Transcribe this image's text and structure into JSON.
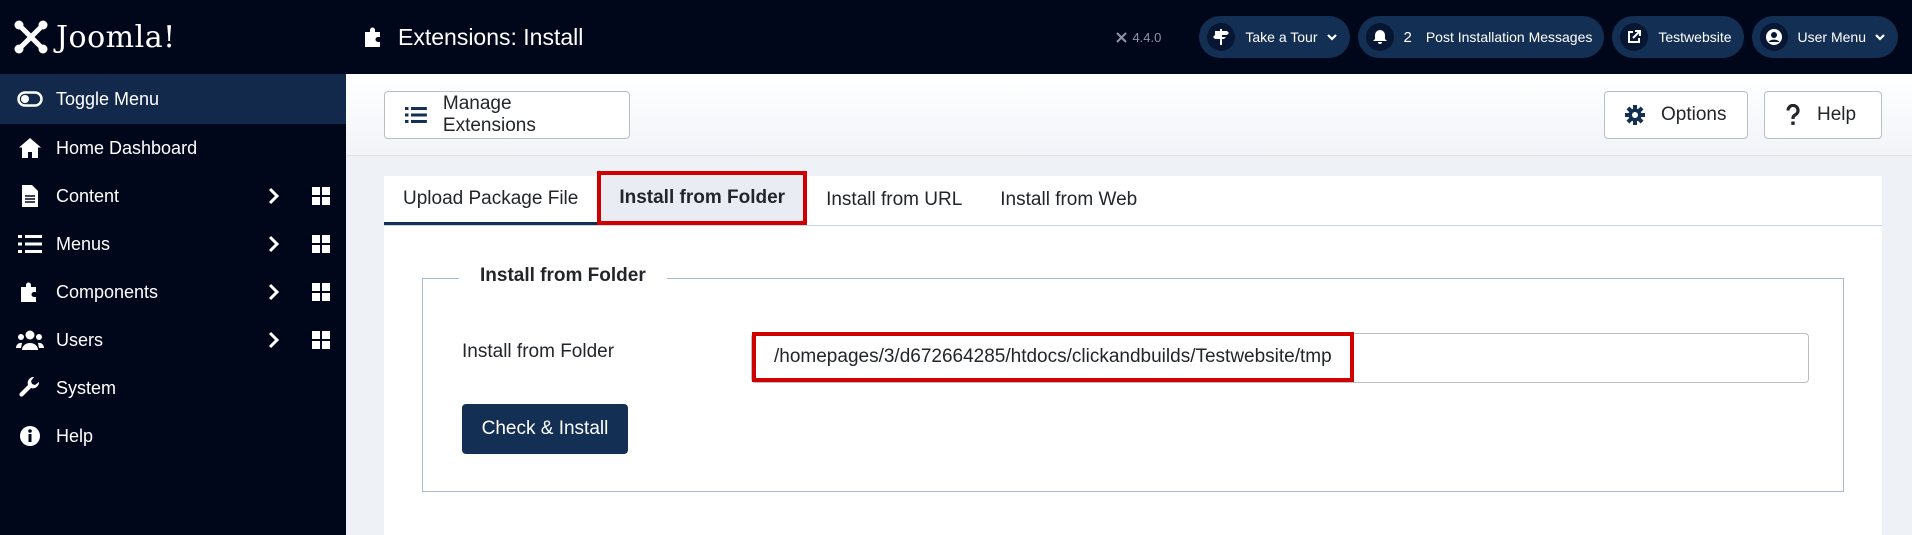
{
  "brand": {
    "logo_text": "Joomla!"
  },
  "header": {
    "page_title": "Extensions: Install",
    "version": "4.4.0",
    "tour_label": "Take a Tour",
    "messages_count": "2",
    "messages_label": "Post Installation Messages",
    "site_label": "Testwebsite",
    "user_menu_label": "User Menu"
  },
  "sidebar": {
    "items": [
      {
        "label": "Toggle Menu",
        "icon": "toggle-icon"
      },
      {
        "label": "Home Dashboard",
        "icon": "home-icon"
      },
      {
        "label": "Content",
        "icon": "file-icon"
      },
      {
        "label": "Menus",
        "icon": "list-icon"
      },
      {
        "label": "Components",
        "icon": "puzzle-icon"
      },
      {
        "label": "Users",
        "icon": "users-icon"
      },
      {
        "label": "System",
        "icon": "wrench-icon"
      },
      {
        "label": "Help",
        "icon": "info-icon"
      }
    ]
  },
  "toolbar": {
    "manage_label": "Manage Extensions",
    "options_label": "Options",
    "help_label": "Help"
  },
  "tabs": [
    {
      "label": "Upload Package File"
    },
    {
      "label": "Install from Folder"
    },
    {
      "label": "Install from URL"
    },
    {
      "label": "Install from Web"
    }
  ],
  "form": {
    "legend": "Install from Folder",
    "field_label": "Install from Folder",
    "path_value": "/homepages/3/d672664285/htdocs/clickandbuilds/Testwebsite/tmp",
    "submit_label": "Check & Install"
  },
  "colors": {
    "header_bg": "#00071b",
    "sidebar_active": "#13294b",
    "primary": "#132f53",
    "highlight": "#d00000"
  }
}
